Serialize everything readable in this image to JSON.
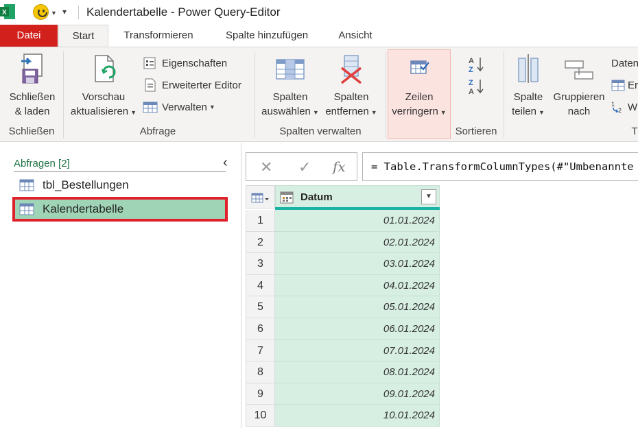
{
  "window": {
    "title": "Kalendertabelle - Power Query-Editor"
  },
  "tabs": [
    {
      "label": "Datei"
    },
    {
      "label": "Start"
    },
    {
      "label": "Transformieren"
    },
    {
      "label": "Spalte hinzufügen"
    },
    {
      "label": "Ansicht"
    }
  ],
  "ribbon": {
    "close_load": {
      "line1": "Schließen",
      "line2": "& laden"
    },
    "group_close": "Schließen",
    "refresh": {
      "line1": "Vorschau",
      "line2": "aktualisieren"
    },
    "properties": "Eigenschaften",
    "advanced_editor": "Erweiterter Editor",
    "manage": "Verwalten",
    "group_query": "Abfrage",
    "choose_columns": {
      "line1": "Spalten",
      "line2": "auswählen"
    },
    "remove_columns": {
      "line1": "Spalten",
      "line2": "entfernen"
    },
    "group_manage_columns": "Spalten verwalten",
    "reduce_rows": {
      "line1": "Zeilen",
      "line2": "verringern"
    },
    "group_sort": "Sortieren",
    "split_column": {
      "line1": "Spalte",
      "line2": "teilen"
    },
    "group_by": {
      "line1": "Gruppieren",
      "line2": "nach"
    },
    "data_type_partial": "Daten",
    "first_row_partial": "Er",
    "replace_partial": "W",
    "group_transform_partial": "T"
  },
  "queries": {
    "title": "Abfragen [2]",
    "items": [
      {
        "label": "tbl_Bestellungen"
      },
      {
        "label": "Kalendertabelle"
      }
    ]
  },
  "formula": {
    "fx": "fx",
    "text": "= Table.TransformColumnTypes(#\"Umbenannte"
  },
  "grid": {
    "column": "Datum",
    "rows": [
      {
        "n": "1",
        "v": "01.01.2024"
      },
      {
        "n": "2",
        "v": "02.01.2024"
      },
      {
        "n": "3",
        "v": "03.01.2024"
      },
      {
        "n": "4",
        "v": "04.01.2024"
      },
      {
        "n": "5",
        "v": "05.01.2024"
      },
      {
        "n": "6",
        "v": "06.01.2024"
      },
      {
        "n": "7",
        "v": "07.01.2024"
      },
      {
        "n": "8",
        "v": "08.01.2024"
      },
      {
        "n": "9",
        "v": "09.01.2024"
      },
      {
        "n": "10",
        "v": "10.01.2024"
      }
    ]
  }
}
